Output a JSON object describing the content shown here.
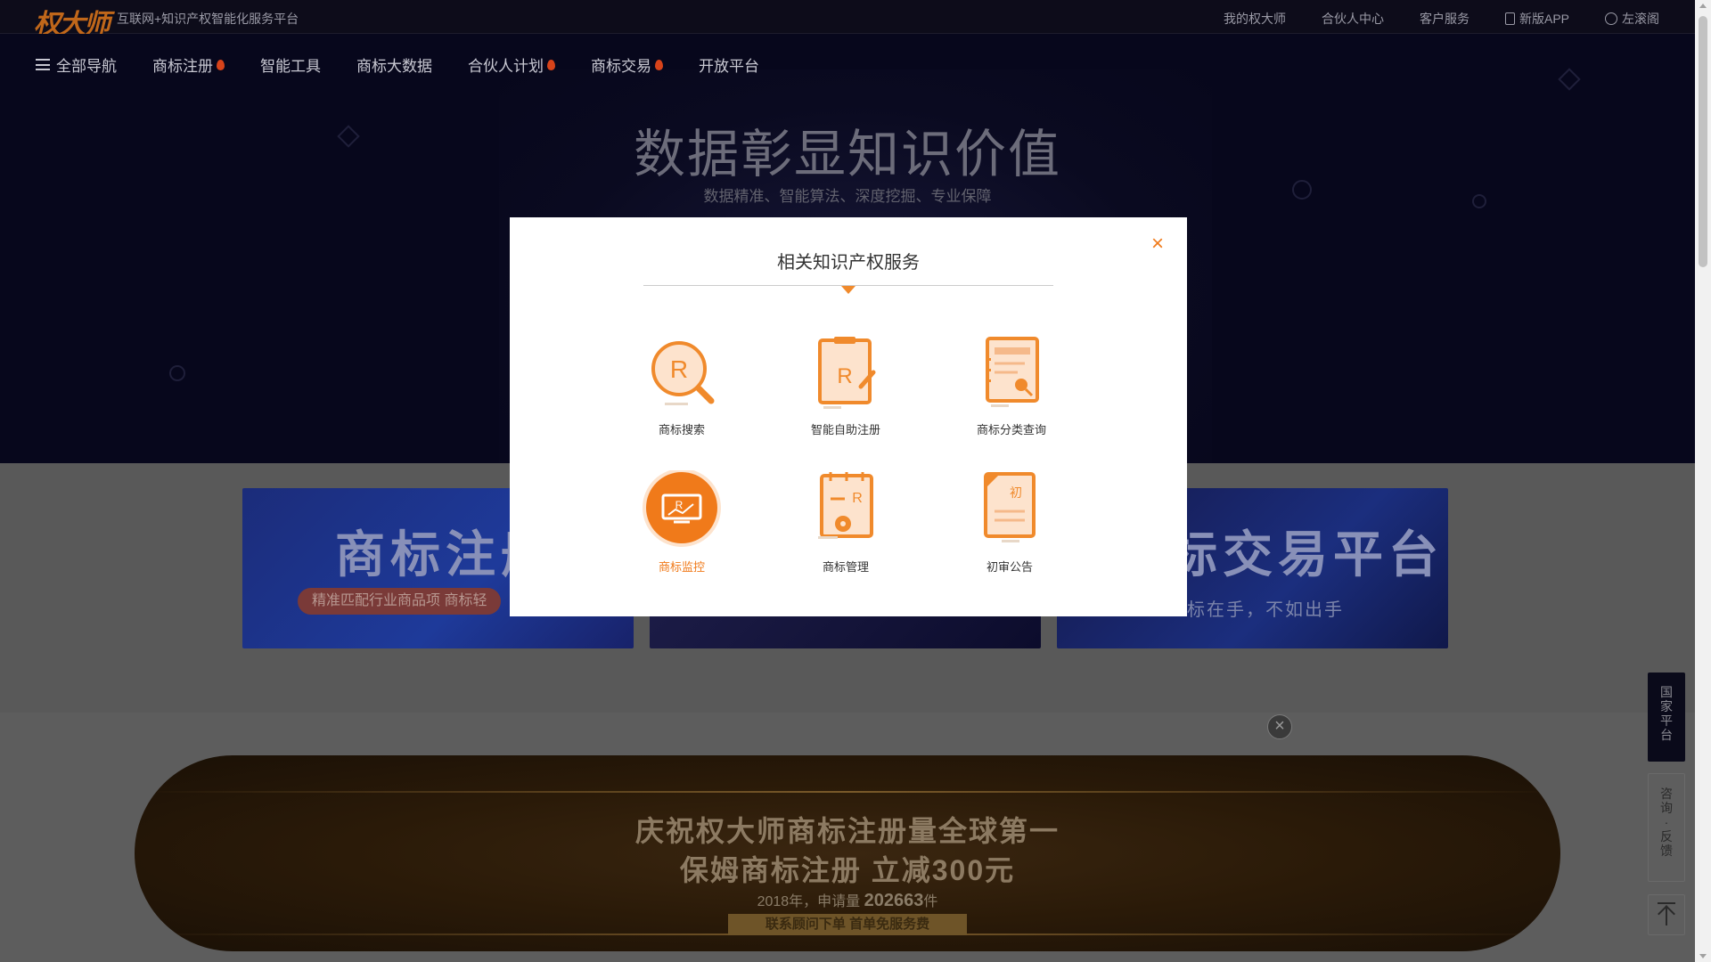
{
  "topbar": {
    "logo": "权大师",
    "slogan": "互联网+知识产权智能化服务平台",
    "links": [
      "我的权大师",
      "合伙人中心",
      "客户服务",
      "新版APP",
      "左滚阁"
    ]
  },
  "nav": {
    "all": "全部导航",
    "items": [
      "商标注册",
      "智能工具",
      "商标大数据",
      "合伙人计划",
      "商标交易",
      "开放平台"
    ]
  },
  "hero": {
    "title": "数据彰显知识价值",
    "subtitle": "数据精准、智能算法、深度挖掘、专业保障"
  },
  "cards": {
    "card1_title": "商标注册",
    "card1_pill": "精准匹配行业商品项 商标轻",
    "card3_title": "标交易平台",
    "card3_sub": "标在手，不如出手"
  },
  "modal": {
    "title": "相关知识产权服务",
    "close": "×",
    "services": [
      {
        "label": "商标搜索",
        "icon": "trademark-search-icon"
      },
      {
        "label": "智能自助注册",
        "icon": "smart-register-icon"
      },
      {
        "label": "商标分类查询",
        "icon": "classification-query-icon"
      },
      {
        "label": "商标监控",
        "icon": "trademark-monitor-icon",
        "active": true
      },
      {
        "label": "商标管理",
        "icon": "trademark-manage-icon"
      },
      {
        "label": "初审公告",
        "icon": "preliminary-notice-icon"
      }
    ]
  },
  "promo": {
    "line1": "庆祝权大师商标注册量全球第一",
    "line2": "保姆商标注册 立减300元",
    "line3_prefix": "2018年，申请量",
    "line3_value": "202663",
    "line3_suffix": "件",
    "line4": "联系顾问下单 首单免服务费",
    "close": "×"
  },
  "float": {
    "national": "国家平台",
    "feedback": "咨询·反馈"
  },
  "colors": {
    "accent": "#f07a1a",
    "dark_bg": "#07071c",
    "overlay": "#595959"
  }
}
